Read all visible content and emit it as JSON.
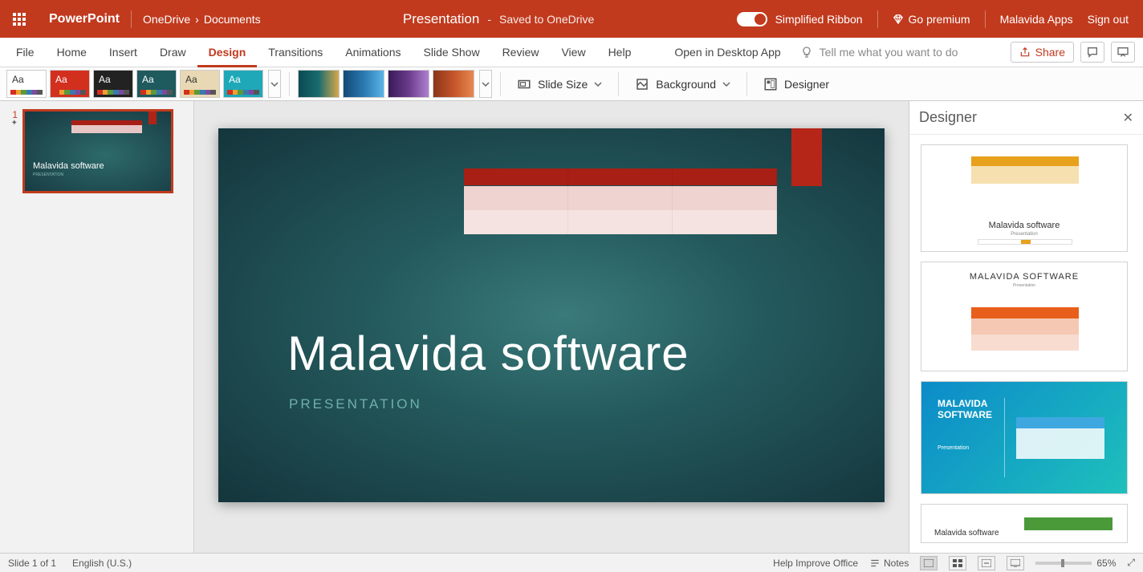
{
  "titlebar": {
    "app_name": "PowerPoint",
    "breadcrumb1": "OneDrive",
    "breadcrumb_sep": "›",
    "breadcrumb2": "Documents",
    "doc_title": "Presentation",
    "dash": "-",
    "saved_status": "Saved to OneDrive",
    "simplified_ribbon": "Simplified Ribbon",
    "go_premium": "Go premium",
    "user_name": "Malavida Apps",
    "sign_out": "Sign out"
  },
  "tabs": {
    "file": "File",
    "home": "Home",
    "insert": "Insert",
    "draw": "Draw",
    "design": "Design",
    "transitions": "Transitions",
    "animations": "Animations",
    "slideshow": "Slide Show",
    "review": "Review",
    "view": "View",
    "help": "Help",
    "open_desktop": "Open in Desktop App",
    "tell_me": "Tell me what you want to do",
    "share": "Share"
  },
  "ribbon": {
    "slide_size": "Slide Size",
    "background": "Background",
    "designer": "Designer"
  },
  "thumbs": {
    "slide1_num": "1",
    "slide1_title": "Malavida software",
    "slide1_sub": "PRESENTATION"
  },
  "slide": {
    "title": "Malavida software",
    "subtitle": "PRESENTATION"
  },
  "designer_panel": {
    "header": "Designer",
    "card1_title": "Malavida software",
    "card1_sub": "Presentation",
    "card2_title": "MALAVIDA SOFTWARE",
    "card2_sub": "Presentation",
    "card3_title": "MALAVIDA SOFTWARE",
    "card3_sub": "Presentation",
    "card4_title": "Malavida software"
  },
  "statusbar": {
    "slide_info": "Slide 1 of 1",
    "language": "English (U.S.)",
    "help_improve": "Help Improve Office",
    "notes": "Notes",
    "zoom_pct": "65%"
  },
  "themes": [
    {
      "bg": "#ffffff",
      "aaColor": "#333",
      "light": true
    },
    {
      "bg": "#d32f1e",
      "aaColor": "#fff"
    },
    {
      "bg": "#222222",
      "aaColor": "#fff"
    },
    {
      "bg": "#1f5a5e",
      "aaColor": "#fff"
    },
    {
      "bg": "#e8d8b4",
      "aaColor": "#333",
      "light": true
    },
    {
      "bg": "#1fa8b8",
      "aaColor": "#fff"
    }
  ],
  "variants": [
    "linear-gradient(90deg,#0a4b52,#1a6b6e,#d6a84c)",
    "linear-gradient(90deg,#144a74,#2a78b0,#5bb5e8)",
    "linear-gradient(90deg,#3a1a5a,#6a3a8a,#b080d0)",
    "linear-gradient(90deg,#8a3518,#c4542a,#e88850)"
  ]
}
